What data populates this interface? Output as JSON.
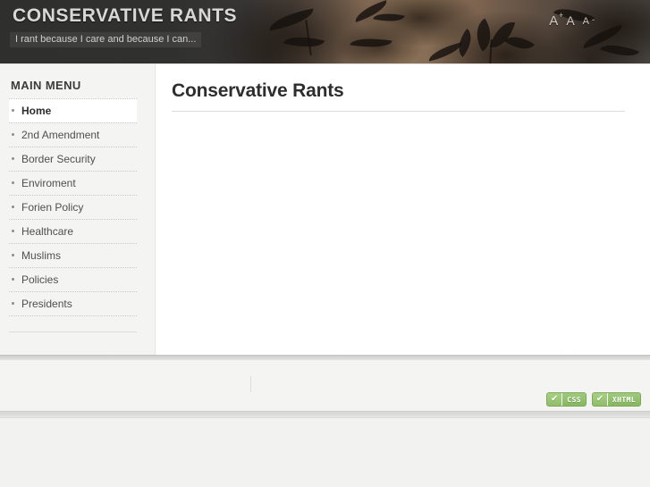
{
  "header": {
    "site_title": "CONSERVATIVE RANTS",
    "tagline": "I rant because I care and because I can...",
    "font_sizer": {
      "large_label": "A",
      "large_sup": "+",
      "medium_label": "A",
      "small_label": "A",
      "small_sub": "-"
    }
  },
  "sidebar": {
    "title": "MAIN MENU",
    "items": [
      {
        "label": "Home",
        "active": true
      },
      {
        "label": "2nd Amendment",
        "active": false
      },
      {
        "label": "Border Security",
        "active": false
      },
      {
        "label": "Enviroment",
        "active": false
      },
      {
        "label": "Forien Policy",
        "active": false
      },
      {
        "label": "Healthcare",
        "active": false
      },
      {
        "label": "Muslims",
        "active": false
      },
      {
        "label": "Policies",
        "active": false
      },
      {
        "label": "Presidents",
        "active": false
      }
    ]
  },
  "content": {
    "title": "Conservative Rants",
    "body": ""
  },
  "footer": {
    "left_link": "",
    "right_link": "",
    "validators": [
      {
        "check": "✔",
        "label": "CSS"
      },
      {
        "check": "✔",
        "label": "XHTML"
      }
    ]
  },
  "colors": {
    "header_dark": "#2f2f2e",
    "header_warm": "#8d7359",
    "sidebar_bg": "#f4f5f2",
    "content_bg": "#ffffff",
    "page_bg": "#f2f3f0",
    "badge_green": "#8fbf6a",
    "text": "#4f4f4f"
  }
}
